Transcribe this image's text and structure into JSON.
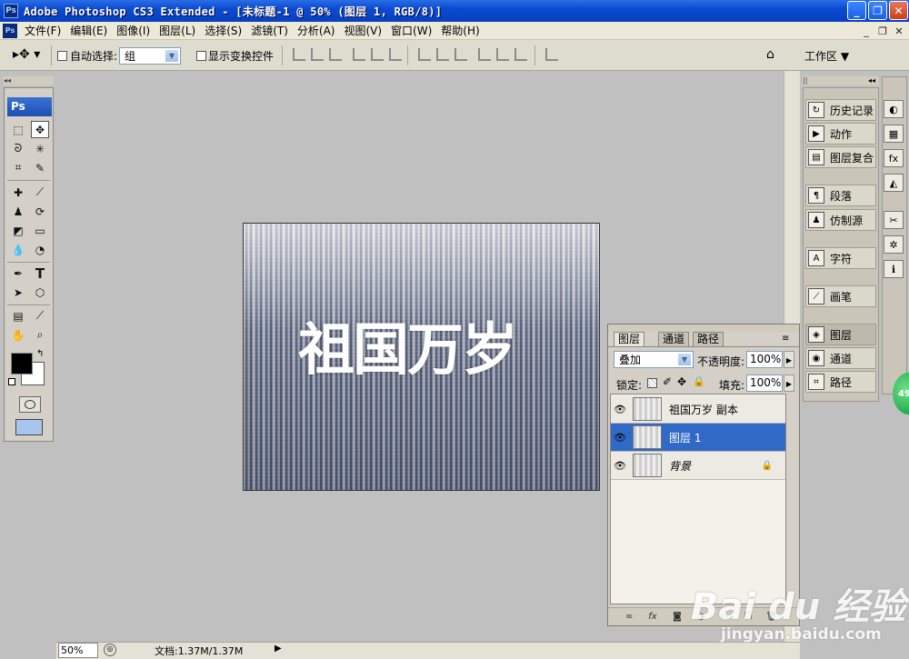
{
  "window": {
    "app_icon": "Ps",
    "title": "Adobe Photoshop CS3 Extended - [未标题-1 @ 50% (图层 1, RGB/8)]",
    "buttons": [
      "_",
      "❐",
      "✕"
    ]
  },
  "menubar": {
    "doc_icon": "Ps",
    "items": [
      "文件(F)",
      "编辑(E)",
      "图像(I)",
      "图层(L)",
      "选择(S)",
      "滤镜(T)",
      "分析(A)",
      "视图(V)",
      "窗口(W)",
      "帮助(H)"
    ],
    "doc_buttons": [
      "_",
      "❐",
      "✕"
    ]
  },
  "options": {
    "auto_select_label": "自动选择:",
    "auto_select_value": "组",
    "show_transform_label": "显示变换控件",
    "workspace_label": "工作区 ▼"
  },
  "toolbox": {
    "header": "Ps"
  },
  "canvas": {
    "text": "祖国万岁"
  },
  "dock": {
    "items": [
      {
        "label": "历史记录",
        "icon": "history-icon"
      },
      {
        "label": "动作",
        "icon": "actions-icon"
      },
      {
        "label": "图层复合",
        "icon": "layer-comps-icon"
      },
      {
        "label": "段落",
        "icon": "paragraph-icon"
      },
      {
        "label": "仿制源",
        "icon": "clone-source-icon"
      },
      {
        "label": "字符",
        "icon": "character-icon"
      },
      {
        "label": "画笔",
        "icon": "brushes-icon"
      },
      {
        "label": "图层",
        "icon": "layers-icon"
      },
      {
        "label": "通道",
        "icon": "channels-icon"
      },
      {
        "label": "路径",
        "icon": "paths-icon"
      }
    ]
  },
  "layers_panel": {
    "tabs": [
      "图层",
      "通道",
      "路径"
    ],
    "blend_mode": "叠加",
    "opacity_label": "不透明度:",
    "opacity_value": "100%",
    "lock_label": "锁定:",
    "fill_label": "填充:",
    "fill_value": "100%",
    "layers": [
      {
        "name": "祖国万岁 副本",
        "selected": false
      },
      {
        "name": "图层 1",
        "selected": true
      },
      {
        "name": "背景",
        "selected": false,
        "locked": true
      }
    ]
  },
  "status": {
    "zoom": "50%",
    "doc_info": "文档:1.37M/1.37M"
  },
  "watermark": {
    "logo": "Bai du 经验",
    "url": "jingyan.baidu.com",
    "badge": "49"
  }
}
